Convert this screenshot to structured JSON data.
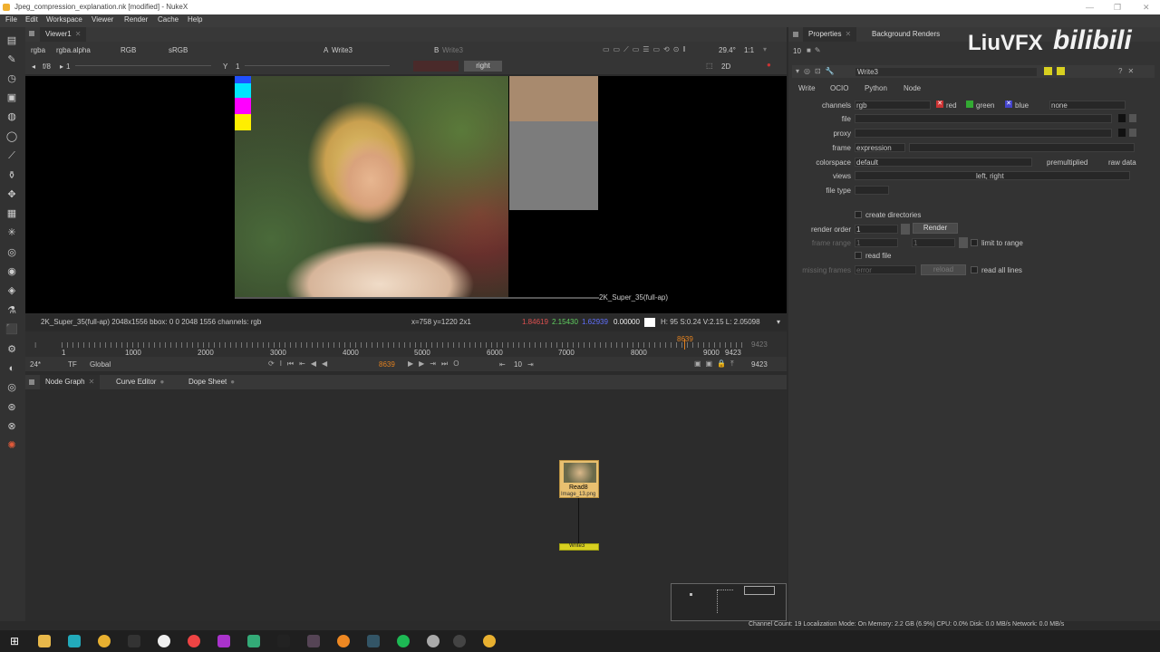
{
  "window": {
    "title": "Jpeg_compression_explanation.nk [modified] - NukeX"
  },
  "menu": [
    "File",
    "Edit",
    "Workspace",
    "Viewer",
    "Render",
    "Cache",
    "Help"
  ],
  "viewer": {
    "tab": "Viewer1",
    "channels": "rgba",
    "alpha": "rgba.alpha",
    "color": "RGB",
    "lut": "sRGB",
    "input_a": "A",
    "input_a_node": "Write3",
    "input_b": "B",
    "input_b_node": "Write3",
    "gain_label": "f/8",
    "gain_value": "1",
    "gamma_label": "Y",
    "gamma_value": "1",
    "view": "right",
    "zoom": "29.4°",
    "ratio": "1:1",
    "mode": "2D",
    "format_label": "2K_Super_35(full-ap)",
    "info_left": "2K_Super_35(full-ap) 2048x1556  bbox: 0 0 2048 1556 channels: rgb",
    "coords": "x=758 y=1220 2x1",
    "px_r": "1.84619",
    "px_g": "2.15430",
    "px_b": "1.62939",
    "px_a": "0.00000",
    "hsvl": "H: 95 S:0.24 V:2.15  L: 2.05098"
  },
  "timeline": {
    "ticks": [
      "1",
      "1000",
      "2000",
      "3000",
      "4000",
      "5000",
      "6000",
      "7000",
      "8000",
      "9000",
      "9423"
    ],
    "end": "9423",
    "current": "8639",
    "fps": "24*",
    "tf": "TF",
    "scope": "Global",
    "step": "10",
    "out": "9423"
  },
  "panels": {
    "node_graph": "Node Graph",
    "curve_editor": "Curve Editor",
    "dope_sheet": "Dope Sheet"
  },
  "nodes": {
    "read": "Read8",
    "read_sub": "Image_13.png",
    "write": "Write3"
  },
  "properties": {
    "tab1": "Properties",
    "tab2": "Background Renders",
    "count": "10",
    "node_name": "Write3",
    "subtabs": [
      "Write",
      "OCIO",
      "Python",
      "Node"
    ],
    "channels_label": "channels",
    "channels_value": "rgb",
    "red": "red",
    "green": "green",
    "blue": "blue",
    "none": "none",
    "file_label": "file",
    "proxy_label": "proxy",
    "frame_label": "frame",
    "frame_value": "expression",
    "colorspace_label": "colorspace",
    "colorspace_value": "default",
    "premult": "premultiplied",
    "raw": "raw data",
    "views_label": "views",
    "views_value": "left, right",
    "filetype_label": "file type",
    "create_dirs": "create directories",
    "render_order_label": "render order",
    "render_order_value": "1",
    "render_btn": "Render",
    "frame_range_label": "frame range",
    "fr1": "1",
    "fr2": "1",
    "limit": "limit to range",
    "read_file": "read file",
    "missing_label": "missing frames",
    "missing_value": "error",
    "reload": "reload",
    "read_all": "read all lines"
  },
  "watermark": {
    "brand": "LiuVFX",
    "logo": "bilibili"
  },
  "status": "Channel Count: 19  Localization Mode: On  Memory: 2.2 GB (6.9%)  CPU: 0.0%  Disk: 0.0 MB/s  Network: 0.0 MB/s"
}
